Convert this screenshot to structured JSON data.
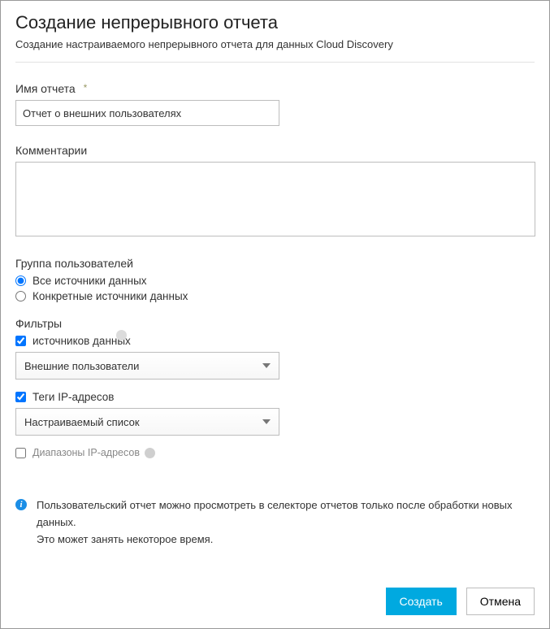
{
  "header": {
    "title": "Создание непрерывного отчета",
    "subtitle": "Создание настраиваемого непрерывного отчета для данных Cloud Discovery"
  },
  "reportName": {
    "label": "Имя отчета",
    "required_mark": "*",
    "value": "Отчет о внешних пользователях"
  },
  "comments": {
    "label": "Комментарии",
    "value": ""
  },
  "userGroup": {
    "heading": "Группа пользователей",
    "options": {
      "all": "Все источники данных",
      "specific": "Конкретные источники данных"
    },
    "selected": "all"
  },
  "filters": {
    "heading": "Фильтры",
    "dataSources": {
      "label": "источников данных",
      "checked": true,
      "selectValue": "Внешние пользователи"
    },
    "ipTags": {
      "label": "Теги IP-адресов",
      "checked": true,
      "selectValue": "Настраиваемый список"
    },
    "ipRanges": {
      "label": "Диапазоны IP-адресов",
      "checked": false
    }
  },
  "info": {
    "line1": "Пользовательский отчет можно просмотреть в селекторе отчетов только после обработки новых данных.",
    "line2": "Это может занять некоторое время."
  },
  "footer": {
    "create": "Создать",
    "cancel": "Отмена"
  }
}
